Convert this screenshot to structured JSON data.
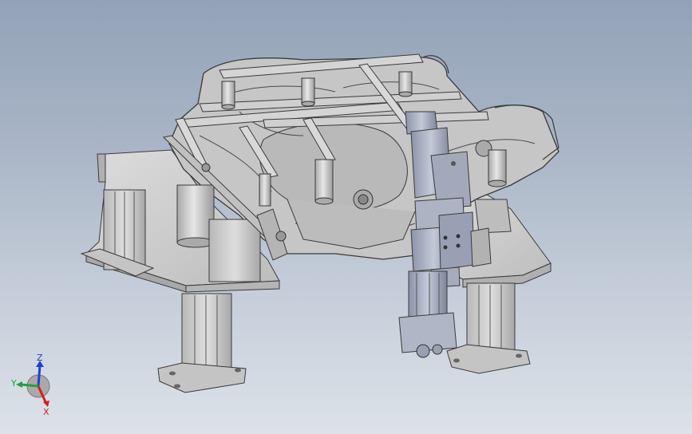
{
  "viewport": {
    "background_top": "#93a2b7",
    "background_bottom": "#dde2e9"
  },
  "model": {
    "part_color": "#c9c9c9",
    "edge_color": "#3a3a3a"
  },
  "triad": {
    "x_label": "X",
    "y_label": "Y",
    "z_label": "Z",
    "x_color": "#d42020",
    "y_color": "#20a040",
    "z_color": "#2040d0"
  }
}
